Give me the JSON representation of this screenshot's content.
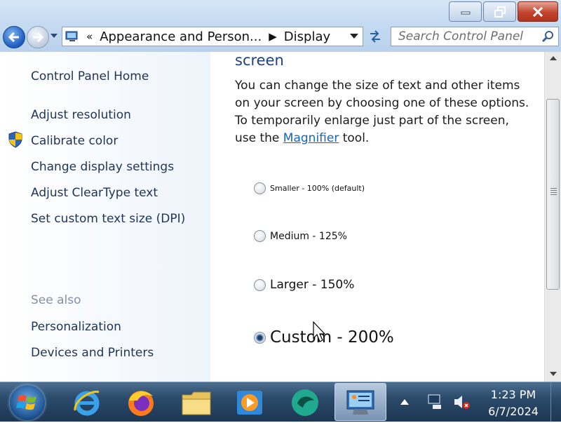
{
  "address": {
    "prefix": "«",
    "crumb_1": "Appearance and Person...",
    "separator": "▶",
    "crumb_2": "Display"
  },
  "search": {
    "placeholder": "Search Control Panel"
  },
  "sidebar": {
    "home": "Control Panel Home",
    "items": [
      {
        "label": "Adjust resolution"
      },
      {
        "label": "Calibrate color"
      },
      {
        "label": "Change display settings"
      },
      {
        "label": "Adjust ClearType text"
      },
      {
        "label": "Set custom text size (DPI)"
      }
    ],
    "see_also": "See also",
    "see_also_items": [
      {
        "label": "Personalization"
      },
      {
        "label": "Devices and Printers"
      }
    ]
  },
  "main": {
    "heading": "screen",
    "paragraph_start": "You can change the size of text and other items on your screen by choosing one of these options. To temporarily enlarge just part of the screen, use the ",
    "link": "Magnifier",
    "paragraph_end": " tool.",
    "options": [
      {
        "label": "Smaller - 100% (default)",
        "checked": false
      },
      {
        "label": "Medium - 125%",
        "checked": false
      },
      {
        "label": "Larger - 150%",
        "checked": false
      },
      {
        "label": "Custom - 200%",
        "checked": true
      }
    ]
  },
  "taskbar": {
    "time": "1:23 PM",
    "date": "6/7/2024",
    "pinned": [
      "windows-start-icon",
      "internet-explorer-icon",
      "firefox-icon",
      "file-explorer-icon",
      "media-player-icon",
      "unknown-app-icon",
      "control-panel-icon"
    ]
  },
  "colors": {
    "link": "#1565b8",
    "heading": "#1e3f87",
    "sidebar_text": "#1e3456"
  }
}
